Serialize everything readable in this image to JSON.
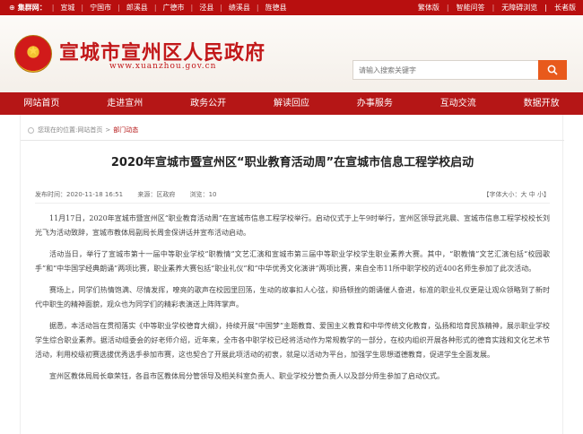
{
  "topbar": {
    "cluster_label": "集群网：",
    "cities": [
      "宣城",
      "宁国市",
      "郎溪县",
      "广德市",
      "泾县",
      "绩溪县",
      "旌德县"
    ],
    "links": [
      "繁体版",
      "智能问答",
      "无障碍浏览",
      "|",
      "长者版"
    ]
  },
  "header": {
    "title": "宣城市宣州区人民政府",
    "url": "www.xuanzhou.gov.cn",
    "search_placeholder": "请输入搜索关键字"
  },
  "nav": {
    "items": [
      "网站首页",
      "走进宣州",
      "政务公开",
      "解读回应",
      "办事服务",
      "互动交流",
      "数据开放"
    ]
  },
  "breadcrumb": {
    "prefix": "您现在的位置:",
    "home": "网站首页",
    "sep": ">",
    "current": "部门动态"
  },
  "article": {
    "title": "2020年宣城市暨宣州区“职业教育活动周”在宣城市信息工程学校启动",
    "meta_date_label": "发布时间：",
    "meta_date": "2020-11-18 16:51",
    "meta_source_label": "来源：",
    "meta_source": "区政府",
    "meta_views_label": "浏览：",
    "meta_views": "10",
    "font_size_label": "【字体大小：大 中 小】",
    "paragraphs": [
      "11月17日，2020年宣城市暨宣州区“职业教育活动周”在宣城市信息工程学校举行。启动仪式于上午9时举行，宣州区领导武兆晨、宣城市信息工程学校校长刘光飞为活动致辞，宣城市教体局副局长周金保讲话并宣布活动启动。",
      "活动当日，举行了宣城市第十一届中等职业学校“职教情”文艺汇演和宣城市第三届中等职业学校学生职业素养大赛。其中，“职教情”文艺汇演包括“校园歌手”和“中华国学经典朗诵”两项比赛，职业素养大赛包括“职业礼仪”和“中华优秀文化演讲”两项比赛，来自全市11所中职学校的近400名师生参加了此次活动。",
      "赛场上，同学们热情饱满、尽情发挥，嘹亮的歌声在校园里回荡，生动的故事扣人心弦，抑扬顿挫的朗诵催人奋进，标准的职业礼仪更是让观众领略到了新时代中职生的精神面貌，观众也为同学们的精彩表演送上阵阵掌声。",
      "据悉，本活动旨在贯彻落实《中等职业学校德育大纲》，持续开展“中国梦”主题教育、爱国主义教育和中华传统文化教育，弘扬和培育民族精神，展示职业学校学生综合职业素养。据活动组委会的好老师介绍，近年来，全市各中职学校已经将活动作为常规教学的一部分，在校内组织开展各种形式的德育实践和文化艺术节活动，利用校级初赛选拔优秀选手参加市赛，这也契合了开展此项活动的初衷，就是以活动为平台，加强学生思想道德教育，促进学生全面发展。",
      "宣州区教体局局长章荣钰，各县市区教体局分管领导及相关科室负责人、职业学校分管负责人以及部分师生参加了启动仪式。"
    ]
  },
  "colors": {
    "brand_red": "#b51616",
    "search_orange": "#e85a1c"
  }
}
